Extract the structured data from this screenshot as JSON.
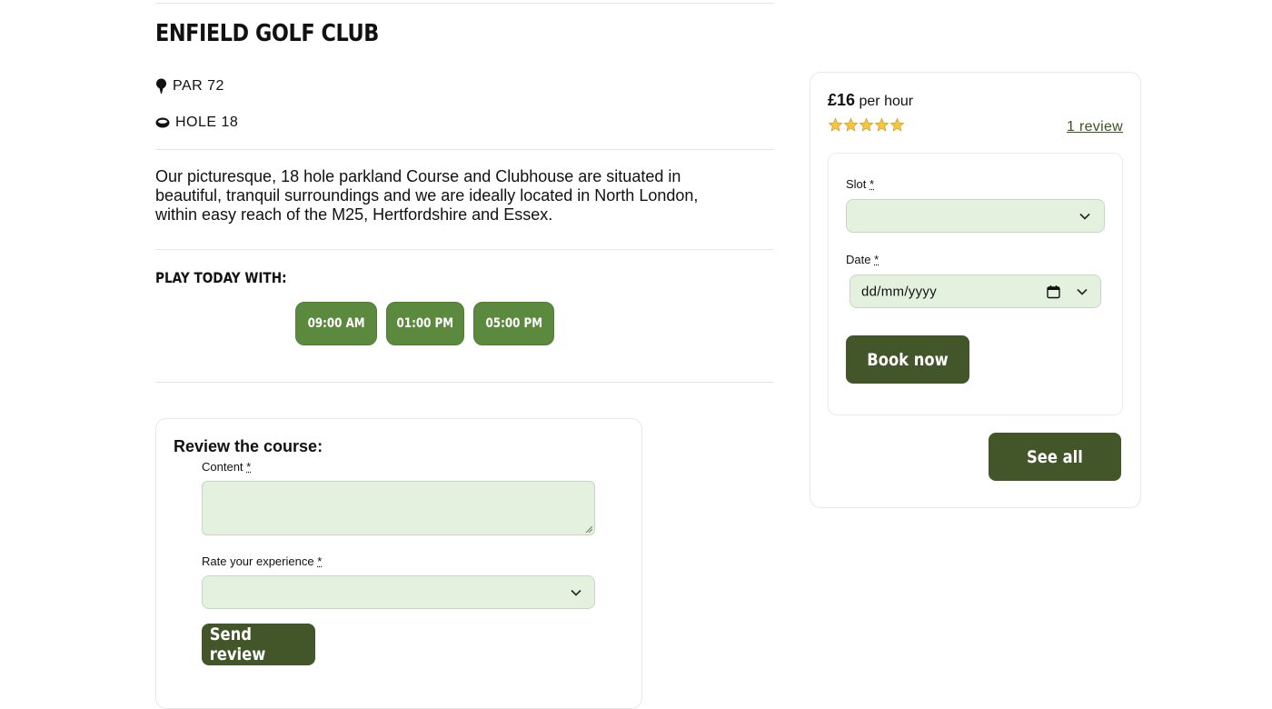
{
  "course": {
    "name": "ENFIELD GOLF CLUB",
    "par_label": "PAR 72",
    "hole_label": "HOLE 18",
    "description": "Our picturesque, 18 hole parkland Course and Clubhouse are situated in beautiful, tranquil surroundings and we are ideally located in North London, within easy reach of the M25, Hertfordshire and Essex."
  },
  "play_today": {
    "label": "PLAY TODAY WITH:",
    "slots": [
      "09:00 AM",
      "01:00 PM",
      "05:00 PM"
    ]
  },
  "review_form": {
    "title": "Review the course:",
    "content_label": "Content",
    "rate_label": "Rate your experience",
    "required_mark": "*",
    "submit_label": "Send review"
  },
  "booking": {
    "price": "£16",
    "price_unit": "per hour",
    "rating": 5,
    "review_link": "1 review",
    "slot_label": "Slot",
    "date_label": "Date",
    "date_placeholder": "dd/mm/yyyy",
    "required_mark": "*",
    "book_label": "Book now",
    "see_all_label": "See all"
  },
  "colors": {
    "slot_button": "#5b8a3f",
    "dark_button": "#43562a",
    "field_bg": "#e4f1df",
    "star": "#f5c542"
  },
  "icons": {
    "par": "golf-tee-icon",
    "hole": "golf-hole-icon",
    "calendar": "calendar-icon",
    "chevron": "chevron-down-icon",
    "star": "star-icon"
  }
}
